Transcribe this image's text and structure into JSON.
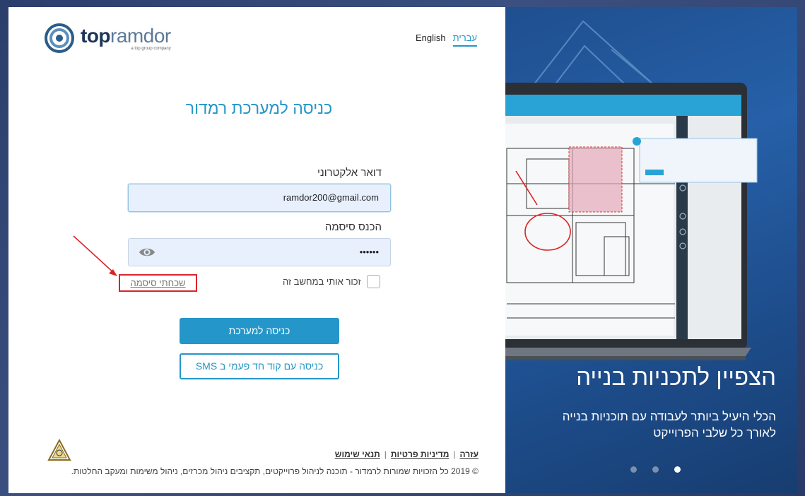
{
  "brand": {
    "logo_prefix": "top",
    "logo_suffix": "ramdor",
    "tagline": "a top group company"
  },
  "language": {
    "hebrew": "עברית",
    "english": "English",
    "active": "עברית"
  },
  "login": {
    "title": "כניסה למערכת רמדור",
    "email_label": "דואר אלקטרוני",
    "email_value": "ramdor200@gmail.com",
    "password_label": "הכנס סיסמה",
    "password_value": "••••••",
    "remember_label": "זכור אותי במחשב זה",
    "forgot_label": "שכחתי סיסמה",
    "submit_label": "כניסה למערכת",
    "sms_label": "כניסה עם קוד חד פעמי ב SMS"
  },
  "footer": {
    "help": "עזרה",
    "privacy": "מדיניות פרטיות",
    "terms": "תנאי שימוש",
    "separator": "|",
    "copyright": "© 2019 כל הזכויות שמורות לרמדור - תוכנה לניהול פרוייקטים, תקציבים ניהול מכרזים, ניהול משימות ומעקב החלטות."
  },
  "hero": {
    "title": "הצפיין לתכניות בנייה",
    "subtitle": "הכלי היעיל ביותר לעבודה עם תוכניות בנייה לאורך כל שלבי הפרוייקט",
    "slide_count": 3,
    "active_slide": 3
  },
  "colors": {
    "accent": "#2596c9",
    "highlight": "#d9252a",
    "hero_bg": "#2660a8"
  }
}
